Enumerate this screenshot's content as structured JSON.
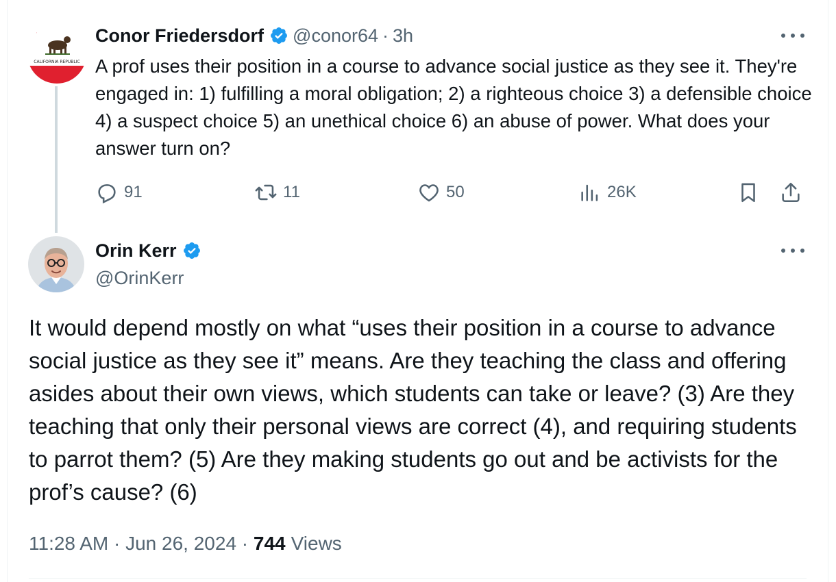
{
  "parent_tweet": {
    "author_name": "Conor Friedersdorf",
    "handle": "@conor64",
    "time": "3h",
    "separator": "·",
    "avatar_icon": "california-flag-bear-icon",
    "text": "A prof uses their position in a course to advance social justice as they see it. They're engaged in: 1) fulfilling a moral obligation; 2) a righteous choice 3) a defensible choice 4) a suspect choice 5) an unethical choice 6) an abuse of power. What does your answer turn on?",
    "actions": {
      "replies": "91",
      "reposts": "11",
      "likes": "50",
      "views": "26K"
    }
  },
  "reply_tweet": {
    "author_name": "Orin Kerr",
    "handle": "@OrinKerr",
    "text": "It would depend mostly on what “uses their position in a course to advance social justice as they see it” means. Are they teaching the class and offering asides about their own views, which students can take or leave? (3) Are they teaching that only their personal views are correct (4), and requiring students to parrot them? (5)  Are they making students go out and be activists for the prof’s cause? (6)",
    "timestamp": "11:28 AM · Jun 26, 2024 · ",
    "views_count": "744",
    "views_label": "Views"
  },
  "colors": {
    "verified_blue": "#1d9bf0",
    "text_primary": "#0f1419",
    "text_secondary": "#536471",
    "thread_line": "#cfd9de"
  }
}
